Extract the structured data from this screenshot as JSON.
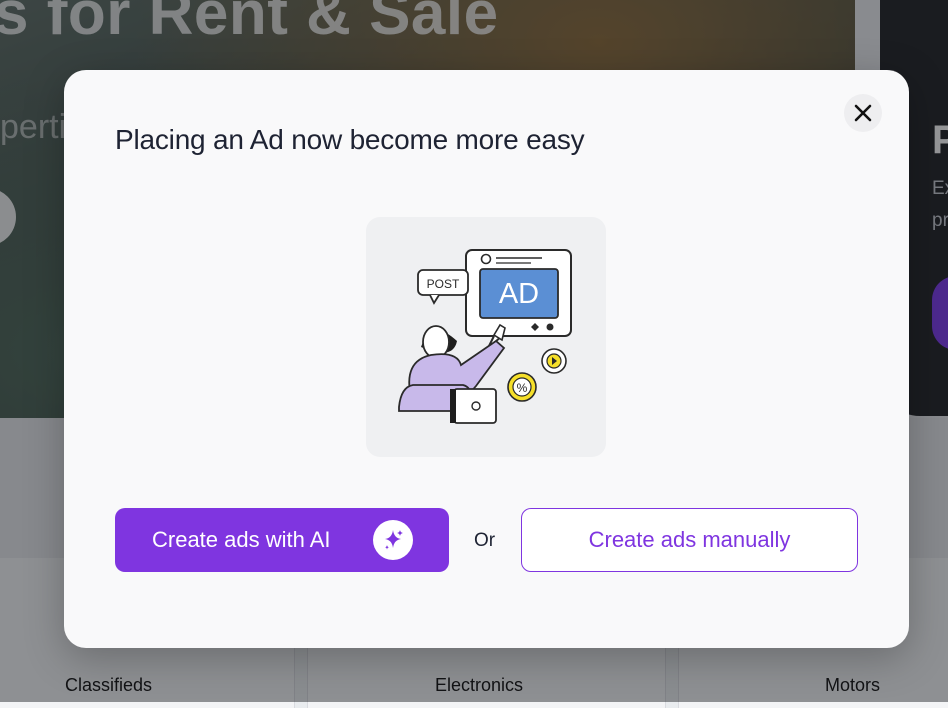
{
  "background": {
    "hero_title": "s for Rent & Sale",
    "hero_subtitle": "perti",
    "right_card": {
      "title": "P",
      "line1": "Ex",
      "line2": "pr"
    },
    "categories": [
      "Classifieds",
      "Electronics",
      "Motors"
    ]
  },
  "modal": {
    "title": "Placing an Ad now become more easy",
    "illustration": {
      "bubble_post": "POST",
      "ad_label": "AD",
      "badge": "%"
    },
    "ai_button_label": "Create ads with AI",
    "or_label": "Or",
    "manual_button_label": "Create ads manually",
    "close_icon": "close-icon",
    "ai_icon": "sparkle-icon"
  },
  "colors": {
    "accent": "#7f35e0",
    "modal_bg": "#f9f9fa",
    "title": "#1e2333"
  }
}
